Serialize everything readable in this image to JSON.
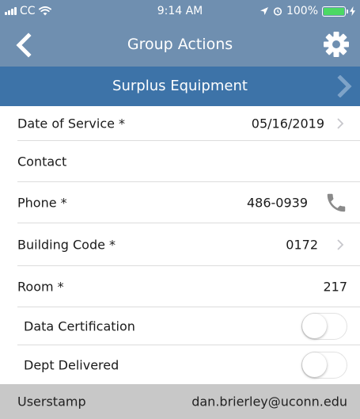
{
  "status_bar": {
    "carrier": "CC",
    "time": "9:14 AM",
    "battery_percent": "100%",
    "battery_level": 1.0
  },
  "nav": {
    "title": "Group Actions",
    "back_icon": "chevron-left-icon",
    "settings_icon": "gear-icon"
  },
  "section": {
    "title": "Surplus Equipment",
    "next_icon": "chevron-right-icon"
  },
  "fields": {
    "date_of_service": {
      "label": "Date of Service *",
      "value": "05/16/2019"
    },
    "contact": {
      "label": "Contact",
      "value": ""
    },
    "phone": {
      "label": "Phone *",
      "value": "486-0939"
    },
    "building_code": {
      "label": "Building Code *",
      "value": "0172"
    },
    "room": {
      "label": "Room *",
      "value": "217"
    },
    "data_certification": {
      "label": "Data Certification",
      "on": false
    },
    "dept_delivered": {
      "label": "Dept Delivered",
      "on": false
    }
  },
  "footer": {
    "label": "Userstamp",
    "value": "dan.brierley@uconn.edu"
  },
  "colors": {
    "nav_bg": "#6f8fb0",
    "section_bg": "#3d73a8",
    "footer_bg": "#c8c8c8",
    "chevron": "#c7c7cc",
    "phone_icon": "#8a8a8a"
  }
}
